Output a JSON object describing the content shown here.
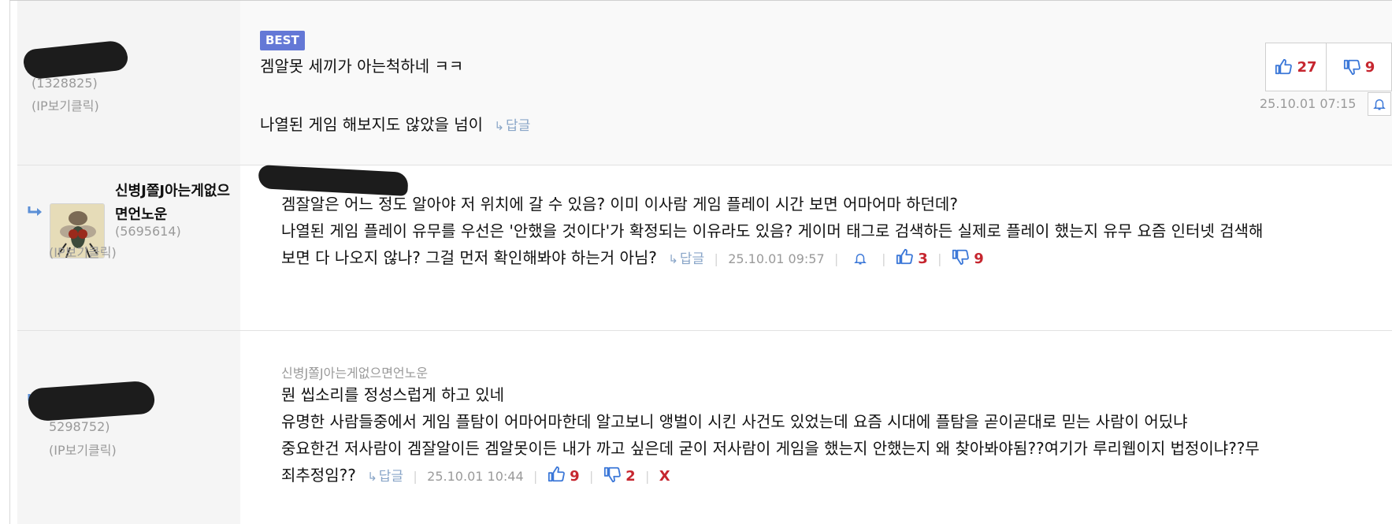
{
  "comments": [
    {
      "badge": "BEST",
      "user_id": "(1328825)",
      "ip_label": "(IP보기클릭)",
      "lines": [
        "겜알못 세끼가 아는척하네 ㅋㅋ",
        "나열된 게임 해보지도 않았을 넘이"
      ],
      "reply_label": "답글",
      "upvotes": "27",
      "downvotes": "9",
      "timestamp": "25.10.01 07:15"
    },
    {
      "nickname": "신병J쫄J아는게없으면언노운",
      "user_id": "(5695614)",
      "ip_label": "(IP보기클릭)",
      "lines": [
        "겜잘알은 어느 정도 알아야 저 위치에 갈 수 있음? 이미 이사람 게임 플레이 시간 보면 어마어마 하던데?",
        "나열된 게임 플레이 유무를 우선은 '안했을 것이다'가 확정되는 이유라도 있음? 게이머 태그로 검색하든 실제로 플레이 했는지 유무 요즘 인터넷 검색해",
        "보면 다 나오지 않나? 그걸 먼저 확인해봐야 하는거 아님?"
      ],
      "reply_label": "답글",
      "timestamp": "25.10.01 09:57",
      "upvotes": "3",
      "downvotes": "9"
    },
    {
      "parent_nickname": "신병J쫄J아는게없으면언노운",
      "user_id": "5298752)",
      "ip_label": "(IP보기클릭)",
      "lines": [
        "뭔 씹소리를 정성스럽게 하고 있네",
        "유명한 사람들중에서 게임 플탐이 어마어마한데 알고보니 앵벌이 시킨 사건도 있었는데 요즘 시대에 플탐을 곧이곧대로 믿는 사람이 어딨냐",
        "중요한건 저사람이 겜잘알이든 겜알못이든 내가 까고 싶은데 굳이 저사람이 게임을 했는지 안했는지 왜 찾아봐야됨??여기가 루리웹이지 법정이냐??무",
        "죄추정임??"
      ],
      "reply_label": "답글",
      "timestamp": "25.10.01 10:44",
      "upvotes": "9",
      "downvotes": "2",
      "delete_label": "X"
    }
  ],
  "colors": {
    "accent_red": "#c6262f",
    "badge_blue": "#6478d6",
    "link_blue": "#8aa6c8",
    "thumb_blue": "#3c78d8"
  },
  "icons": [
    "thumbs-up-icon",
    "thumbs-down-icon",
    "bell-icon",
    "reply-arrow-icon"
  ]
}
